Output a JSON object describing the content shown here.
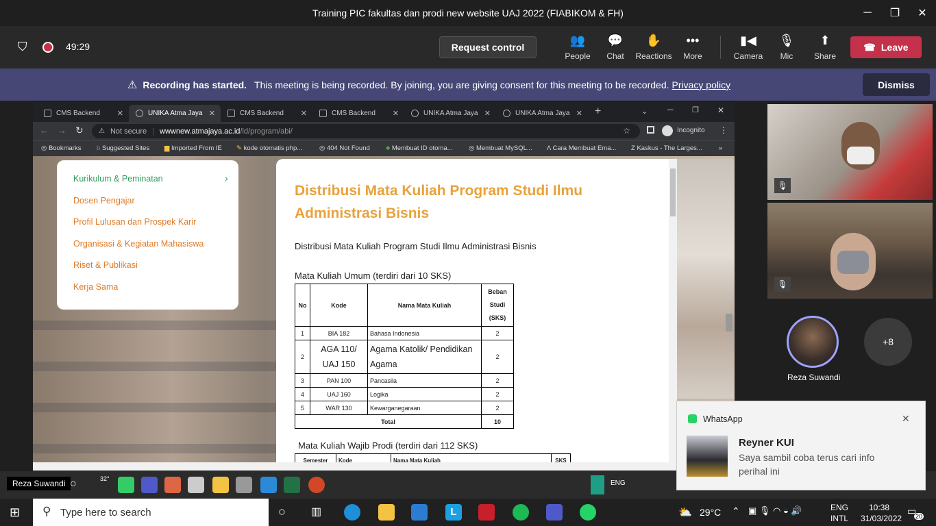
{
  "window": {
    "title": "Training PIC fakultas dan prodi new website UAJ 2022 (FIABIKOM & FH)"
  },
  "meeting": {
    "timer": "49:29",
    "request_control": "Request control",
    "people": "People",
    "chat": "Chat",
    "reactions": "Reactions",
    "more": "More",
    "camera": "Camera",
    "mic": "Mic",
    "share": "Share",
    "leave": "Leave"
  },
  "banner": {
    "bold": "Recording has started.",
    "text": "This meeting is being recorded. By joining, you are giving consent for this meeting to be recorded.",
    "link": "Privacy policy",
    "dismiss": "Dismiss"
  },
  "browser": {
    "tabs": [
      "CMS Backend",
      "UNIKA Atma Jaya",
      "CMS Backend",
      "CMS Backend",
      "UNIKA Atma Jaya",
      "UNIKA Atma Jaya"
    ],
    "not_secure": "Not secure",
    "url_host": "wwwnew.atmajaya.ac.id",
    "url_path": "/id/program/abi/",
    "incognito": "Incognito",
    "bookmarks": [
      "Bookmarks",
      "Suggested Sites",
      "Imported From IE",
      "kode otomatis php...",
      "404 Not Found",
      "Membuat ID otoma...",
      "Membuat MySQL...",
      "Cara Membuat Ema...",
      "Kaskus - The Larges..."
    ],
    "more_bm": "»"
  },
  "side_menu": [
    "Kurikulum & Peminatan",
    "Dosen Pengajar",
    "Profil Lulusan dan Prospek Karir",
    "Organisasi & Kegiatan Mahasiswa",
    "Riset & Publikasi",
    "Kerja Sama"
  ],
  "content": {
    "title": "Distribusi Mata Kuliah Program Studi Ilmu Administrasi Bisnis",
    "subtitle": "Distribusi Mata Kuliah Program Studi Ilmu Administrasi Bisnis",
    "umum_caption": "Mata Kuliah Umum (terdiri dari 10 SKS)",
    "wajib_caption": "Mata Kuliah Wajib Prodi (terdiri dari 112 SKS)",
    "table_headers": {
      "no": "No",
      "kode": "Kode",
      "nama": "Nama Mata Kuliah",
      "beban": "Beban Studi (SKS)"
    },
    "rows": [
      [
        "1",
        "BIA 182",
        "Bahasa Indonesia",
        "2"
      ],
      [
        "2",
        "AGA 110/ UAJ 150",
        "Agama Katolik/ Pendidikan Agama",
        "2"
      ],
      [
        "3",
        "PAN 100",
        "Pancasila",
        "2"
      ],
      [
        "4",
        "UAJ 160",
        "Logika",
        "2"
      ],
      [
        "5",
        "WAR 130",
        "Kewarganegaraan",
        "2"
      ]
    ],
    "total_label": "Total",
    "total_value": "10",
    "table2_headers": [
      "Semester",
      "Kode",
      "Nama Mata Kuliah",
      "SKS"
    ]
  },
  "participants": {
    "name1": "Reza Suwandi",
    "more_count": "+8",
    "presenter": "Reza Suwandi"
  },
  "toast": {
    "app": "WhatsApp",
    "sender": "Reyner KUI",
    "message": "Saya sambil coba terus cari info perihal ini"
  },
  "taskbar": {
    "search_placeholder": "Type here to search",
    "temp": "29°C",
    "lang1": "ENG",
    "lang2": "INTL",
    "time": "10:38",
    "date": "31/03/2022",
    "notif": "20",
    "inner_temp": "32°",
    "inner_lang": "ENG"
  }
}
